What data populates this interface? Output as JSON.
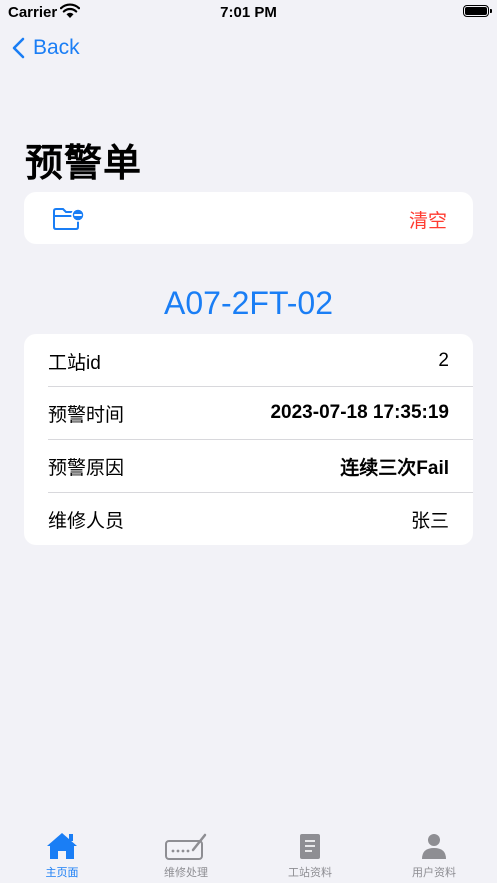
{
  "status_bar": {
    "carrier": "Carrier",
    "time": "7:01 PM"
  },
  "nav": {
    "back_label": "Back"
  },
  "page": {
    "title": "预警单"
  },
  "toolbar": {
    "clear_label": "清空",
    "folder_icon": "folder-minus-icon"
  },
  "station": {
    "code": "A07-2FT-02"
  },
  "details": {
    "rows": [
      {
        "label": "工站id",
        "value": "2"
      },
      {
        "label": "预警时间",
        "value": "2023-07-18 17:35:19"
      },
      {
        "label": "预警原因",
        "value": "连续三次Fail"
      },
      {
        "label": "维修人员",
        "value": "张三"
      }
    ]
  },
  "tabbar": {
    "tabs": [
      {
        "label": "主页面",
        "icon": "home-icon",
        "active": true
      },
      {
        "label": "维修处理",
        "icon": "keyboard-pen-icon",
        "active": false
      },
      {
        "label": "工站资料",
        "icon": "document-icon",
        "active": false
      },
      {
        "label": "用户资料",
        "icon": "person-icon",
        "active": false
      }
    ]
  },
  "colors": {
    "accent": "#1a7ef5",
    "destructive": "#ff3b30",
    "background": "#f2f2f7",
    "inactive": "#8e8e93"
  }
}
